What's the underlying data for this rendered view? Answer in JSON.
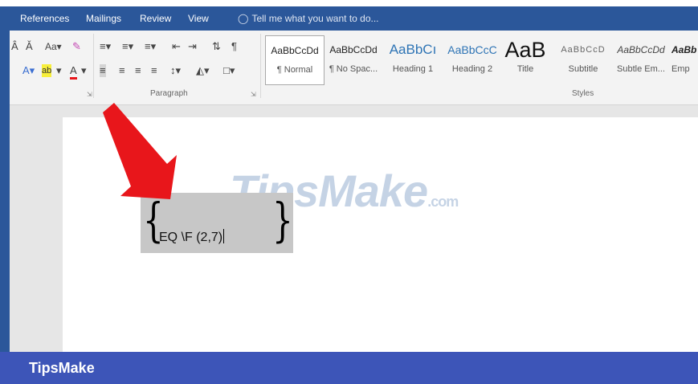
{
  "tabs": [
    "References",
    "Mailings",
    "Review",
    "View"
  ],
  "tell_me": "Tell me what you want to do...",
  "ribbon": {
    "font_row1": [
      "A˄",
      "A˅",
      "Aa -",
      "✂"
    ],
    "paragraph_label": "Paragraph",
    "styles_label": "Styles"
  },
  "styles": [
    {
      "preview": "AaBbCcDd",
      "name": "¶ Normal"
    },
    {
      "preview": "AaBbCcDd",
      "name": "¶ No Spac..."
    },
    {
      "preview": "AaBbCı",
      "name": "Heading 1"
    },
    {
      "preview": "AaBbCcC",
      "name": "Heading 2"
    },
    {
      "preview": "AaB",
      "name": "Title"
    },
    {
      "preview": "AaBbCcD",
      "name": "Subtitle"
    },
    {
      "preview": "AaBbCcDd",
      "name": "Subtle Em..."
    },
    {
      "preview": "AaBb",
      "name": "Emp"
    }
  ],
  "document": {
    "field_code": "EQ \\F (2,7)",
    "brace_left": "{",
    "brace_right": "}"
  },
  "watermark": {
    "main": "TipsMake",
    "suffix": ".com"
  },
  "footer": {
    "brand": "TipsMake"
  },
  "colors": {
    "ribbon_blue": "#2b579a",
    "footer_blue": "#3d55b8",
    "arrow_red": "#e8161b",
    "field_gray": "#c7c7c7"
  }
}
